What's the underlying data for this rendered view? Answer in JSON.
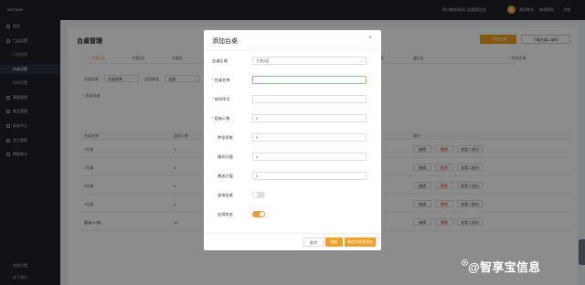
{
  "topbar": {
    "logo": "ARTAND",
    "store": "四川夜场测试门店管理后台",
    "avatar": "账",
    "user": "测试账号",
    "change_password": "修改密码",
    "logout": "注销"
  },
  "sidebar": {
    "items": [
      {
        "label": "首页",
        "sub": false,
        "active": false
      },
      {
        "label": "门店设置",
        "sub": false,
        "active": false
      },
      {
        "label": "门店信息",
        "sub": true,
        "active": false
      },
      {
        "label": "台桌设置",
        "sub": true,
        "active": true
      },
      {
        "label": "包间设置",
        "sub": true,
        "active": false
      },
      {
        "label": "营销管理",
        "sub": false,
        "active": false
      },
      {
        "label": "商品管理",
        "sub": false,
        "active": false
      },
      {
        "label": "财务中心",
        "sub": false,
        "active": false
      },
      {
        "label": "员工管理",
        "sub": false,
        "active": false
      },
      {
        "label": "数据统计",
        "sub": false,
        "active": false
      }
    ],
    "bottom": [
      "系统设置",
      "关于我们"
    ]
  },
  "page": {
    "title": "台桌管理",
    "add_button": "+ 添加台桌",
    "download_button": "下载台桌二维码",
    "area_tabs": [
      "大堂A区",
      "大堂B区",
      "卡座区",
      "包间区",
      "VIP区",
      "吧台区",
      "散台区",
      "二楼区",
      "露台区"
    ],
    "area_add": "+ 添加区域",
    "filters": {
      "name_label": "台桌名称",
      "name_placeholder": "台桌名称",
      "status_label": "启用状态",
      "status_value": "全部"
    },
    "add_row": "+ 添加台桌",
    "columns": [
      "台桌名称",
      "容纳人数",
      "操作"
    ],
    "rows": [
      {
        "name": "1号桌",
        "capacity": "4"
      },
      {
        "name": "2号桌",
        "capacity": "4"
      },
      {
        "name": "3号桌",
        "capacity": "4"
      },
      {
        "name": "4号桌",
        "capacity": "4"
      },
      {
        "name": "圆桌(10座)",
        "capacity": "10"
      }
    ],
    "actions": {
      "edit": "编辑",
      "delete": "删除",
      "qrcode": "查看二维码"
    }
  },
  "modal": {
    "title": "添加台桌",
    "close_icon": "close-icon",
    "fields": {
      "area": {
        "label": "台桌区域",
        "value": "大堂A区"
      },
      "name": {
        "label": "台桌名称",
        "value": "",
        "required": true
      },
      "seq": {
        "label": "排序序号",
        "value": "",
        "required": true
      },
      "capacity": {
        "label": "容纳人数",
        "value": "0",
        "required": true
      },
      "deposit": {
        "label": "押金系数",
        "value": "0"
      },
      "service_fee": {
        "label": "服务分值",
        "value": "0"
      },
      "reward": {
        "label": "赠送分值",
        "value": "0"
      },
      "virtual": {
        "label": "虚拟台桌",
        "on": false
      },
      "enabled": {
        "label": "启用状态",
        "on": true
      }
    },
    "buttons": {
      "cancel": "取消",
      "ok": "确定",
      "continue": "确定并继续添加"
    }
  },
  "watermark": "@智享宝信息",
  "colors": {
    "accent": "#f0a020",
    "danger": "#e0301e",
    "sidebar": "#1f2229"
  }
}
